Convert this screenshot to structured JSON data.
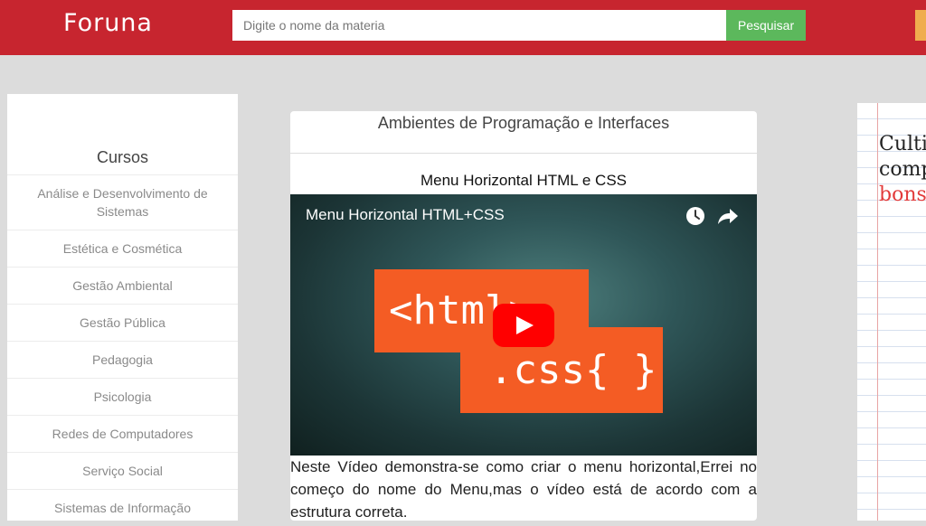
{
  "header": {
    "logo": "Foruna",
    "search_placeholder": "Digite o nome da materia",
    "search_button": "Pesquisar"
  },
  "sidebar": {
    "title": "Cursos",
    "courses": [
      "Análise e Desenvolvimento de Sistemas",
      "Estética e Cosmética",
      "Gestão Ambiental",
      "Gestão Pública",
      "Pedagogia",
      "Psicologia",
      "Redes de Computadores",
      "Serviço Social",
      "Sistemas de Informação"
    ]
  },
  "main": {
    "section_title": "Ambientes de Programação e Interfaces",
    "video_heading": "Menu Horizontal HTML e CSS",
    "video": {
      "title": "Menu Horizontal HTML+CSS",
      "thumb_html": "<html>",
      "thumb_css": ".css{ }"
    },
    "description": "Neste Vídeo demonstra-se como criar o menu horizontal,Errei no começo do nome do Menu,mas o vídeo está de acordo com a estrutura correta."
  },
  "ad": {
    "line1": "Culti",
    "line2": "comp",
    "line3": "bons"
  },
  "colors": {
    "header_bg": "#c7252f",
    "search_button_bg": "#5cb85c",
    "thumb_orange": "#f45c24",
    "play_red": "#ff0000"
  },
  "icons": [
    "clock-icon",
    "share-icon",
    "play-icon"
  ]
}
